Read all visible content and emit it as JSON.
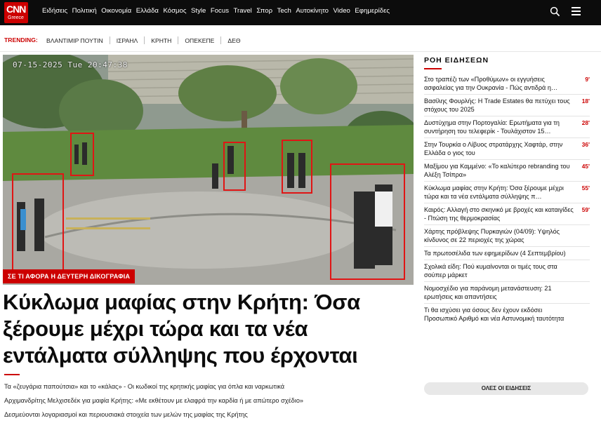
{
  "header": {
    "logo": "CNN",
    "logo_sub": "Greece",
    "nav": [
      "Ειδήσεις",
      "Πολιτική",
      "Οικονομία",
      "Ελλάδα",
      "Κόσμος",
      "Style",
      "Focus",
      "Travel",
      "Σπορ",
      "Tech",
      "Αυτοκίνητο",
      "Video",
      "Εφημερίδες"
    ]
  },
  "trending": {
    "label": "TRENDING:",
    "items": [
      "ΒΛΑΝΤΙΜΙΡ ΠΟΥΤΙΝ",
      "ΙΣΡΑΗΛ",
      "ΚΡΗΤΗ",
      "ΟΠΕΚΕΠΕ",
      "ΔΕΘ"
    ]
  },
  "hero": {
    "timestamp": "07-15-2025 Tue 20:47:38",
    "label": "ΣΕ ΤΙ ΑΦΟΡΑ Η ΔΕΥΤΕΡΗ ΔΙΚΟΓΡΑΦΙΑ",
    "headline": "Κύκλωμα μαφίας στην Κρήτη: Όσα ξέρουμε μέχρι τώρα και τα νέα εντάλματα σύλληψης που έρχονται"
  },
  "related": [
    "Τα «ζευγάρια παπούτσια» και το «κάλας» - Οι κωδικοί της κρητικής μαφίας για όπλα και ναρκωτικά",
    "Αρχιμανδρίτης Μελχισεδέκ για μαφία Κρήτης: «Με εκθέτουν με ελαφρά την καρδία ή με απώτερο σχέδιο»",
    "Δεσμεύονται λογαριασμοί και περιουσιακά στοιχεία των μελών της μαφίας της Κρήτης"
  ],
  "feed": {
    "title": "ΡΟΗ ΕΙΔΗΣΕΩΝ",
    "items": [
      {
        "text": "Στο τραπέζι των «Προθύμων» οι εγγυήσεις ασφαλείας για την Ουκρανία - Πώς αντιδρά η…",
        "time": "9'"
      },
      {
        "text": "Βασίλης Φουρλής: Η Trade Estates θα πετύχει τους στόχους του 2025",
        "time": "18'"
      },
      {
        "text": "Δυστύχημα στην Πορτογαλία: Ερωτήματα για τη συντήρηση του τελεφερίκ - Τουλάχιστον 15…",
        "time": "28'"
      },
      {
        "text": "Στην Τουρκία ο Λίβυος στρατάρχης Χαφτάρ, στην Ελλάδα ο γιος του",
        "time": "36'"
      },
      {
        "text": "Μαξίμου για Καμμένο: «Το καλύτερο rebranding του Αλέξη Τσίπρα»",
        "time": "45'"
      },
      {
        "text": "Κύκλωμα μαφίας στην Κρήτη: Όσα ξέρουμε μέχρι τώρα και τα νέα εντάλματα σύλληψης π…",
        "time": "55'"
      },
      {
        "text": "Καιρός: Αλλαγή στο σκηνικό με βροχές και καταιγίδες - Πτώση της θερμοκρασίας",
        "time": "59'"
      },
      {
        "text": "Χάρτης πρόβλεψης Πυρκαγιών (04/09): Υψηλός κίνδυνος σε 22 περιοχές της χώρας",
        "time": ""
      },
      {
        "text": "Τα πρωτοσέλιδα των εφημερίδων (4 Σεπτεμβρίου)",
        "time": ""
      },
      {
        "text": "Σχολικά είδη: Πού κυμαίνονται οι τιμές τους στα σούπερ μάρκετ",
        "time": ""
      },
      {
        "text": "Νομοσχέδιο για παράνομη μετανάστευση: 21 ερωτήσεις και απαντήσεις",
        "time": ""
      },
      {
        "text": "Τι θα ισχύσει για όσους δεν έχουν εκδόσει Προσωπικό Αριθμό και νέα Αστυνομική ταυτότητα",
        "time": ""
      }
    ],
    "all_button": "ΟΛΕΣ ΟΙ ΕΙΔΗΣΕΙΣ"
  },
  "colors": {
    "accent": "#cc0000",
    "header_bg": "#0c0c0c"
  },
  "icons": [
    "search-icon",
    "menu-icon"
  ]
}
